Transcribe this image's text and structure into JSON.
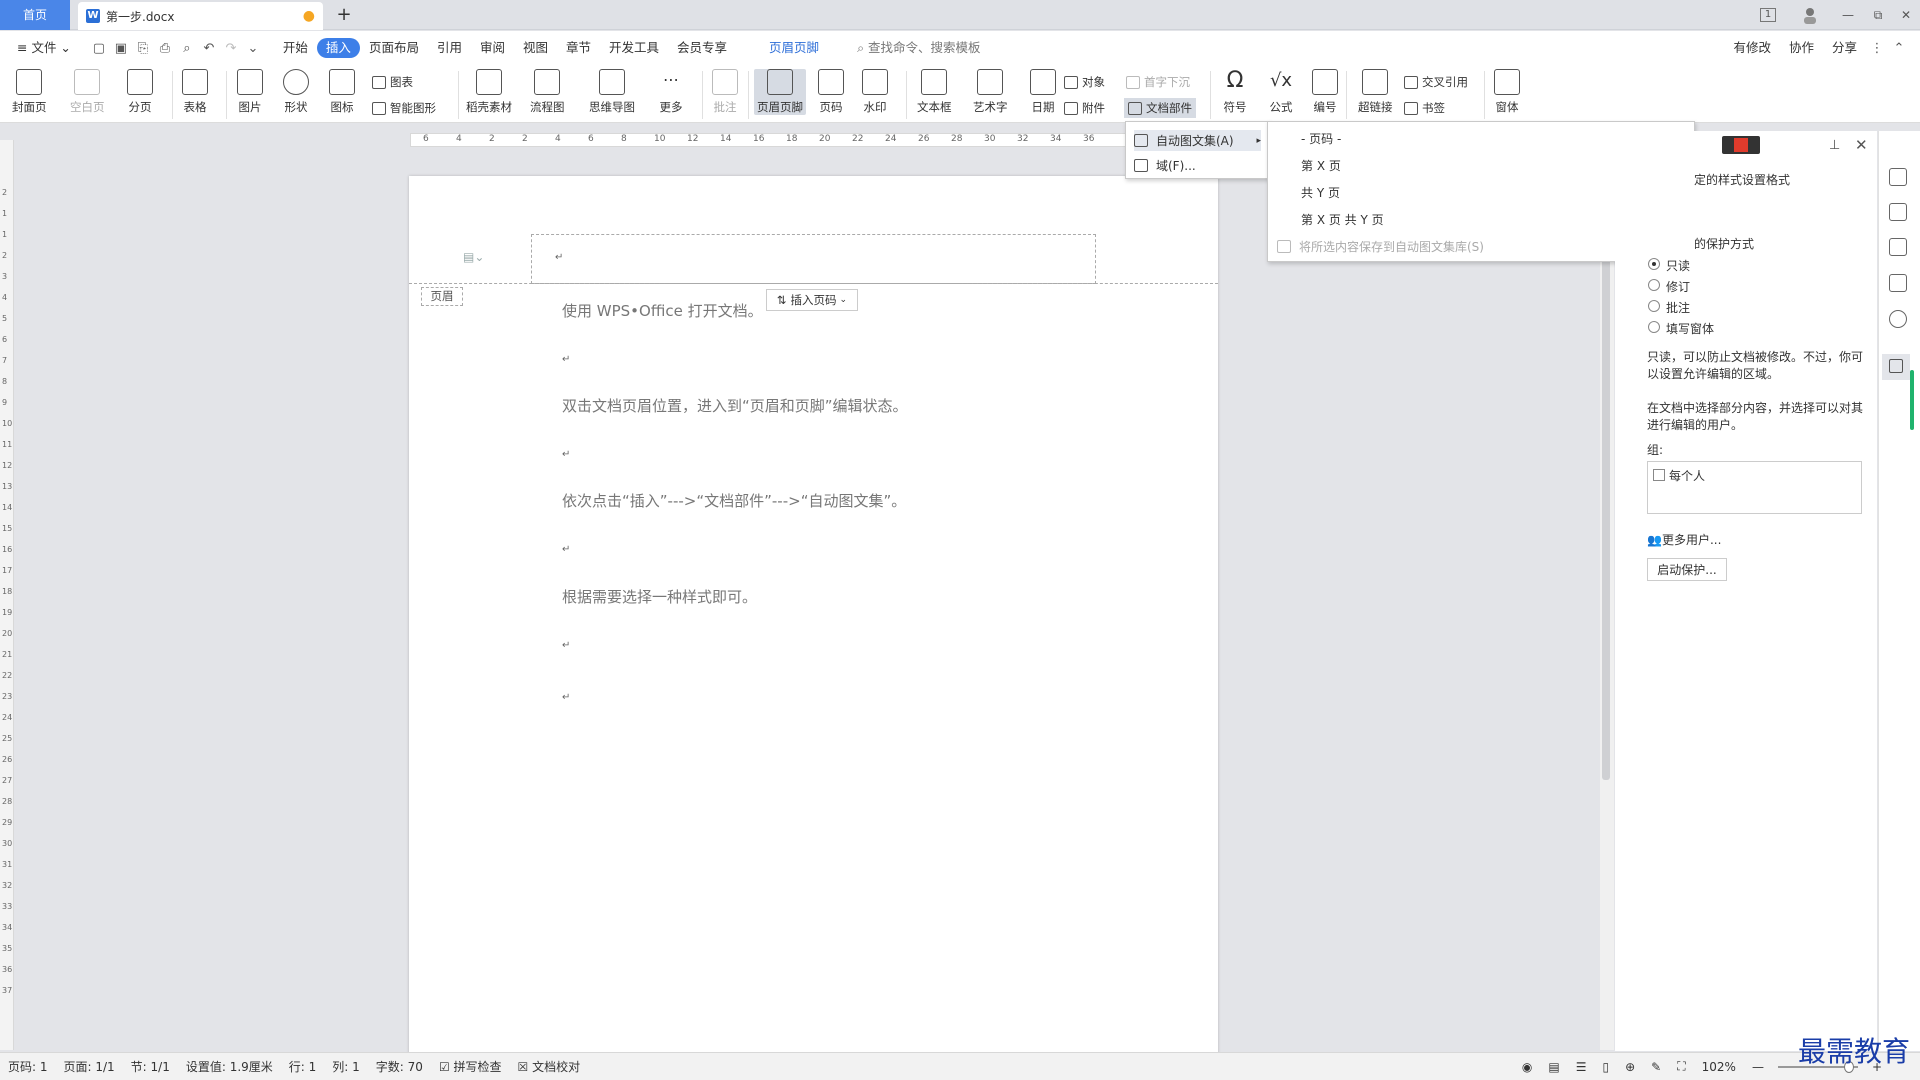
{
  "titlebar": {
    "home_tab": "首页",
    "doc_tab": "第一步.docx",
    "modified_dot": "●",
    "add_tab": "+",
    "ctrl_1": "1",
    "minimize": "—",
    "restore": "⧉",
    "close": "✕"
  },
  "menubar": {
    "file": "≡ 文件 ⌄",
    "tabs": [
      "开始",
      "插入",
      "页面布局",
      "引用",
      "审阅",
      "视图",
      "章节",
      "开发工具",
      "会员专享",
      "页眉页脚"
    ],
    "search": "查找命令、搜索模板",
    "right": [
      "有修改",
      "协作",
      "分享"
    ]
  },
  "ribbon": {
    "buttons": [
      "封面页",
      "空白页",
      "分页",
      "表格",
      "图片",
      "形状",
      "图标",
      "稻壳素材",
      "流程图",
      "思维导图",
      "更多",
      "批注",
      "页眉页脚",
      "页码",
      "水印",
      "文本框",
      "艺术字",
      "日期",
      "编号",
      "超链接",
      "窗体",
      "符号",
      "公式"
    ],
    "small": {
      "chart": "图表",
      "smart": "智能图形",
      "object": "对象",
      "dropcap": "首字下沉",
      "attachment": "附件",
      "docparts": "文档部件",
      "crossref": "交叉引用",
      "bookmark": "书签"
    }
  },
  "ruler_top": [
    "6",
    "4",
    "2",
    "2",
    "4",
    "6",
    "8",
    "10",
    "12",
    "14",
    "16",
    "18",
    "20",
    "22",
    "24",
    "26",
    "28",
    "30",
    "32",
    "34",
    "36"
  ],
  "ruler_left": [
    "2",
    "1",
    "1",
    "2",
    "3",
    "4",
    "5",
    "6",
    "7",
    "8",
    "9",
    "10",
    "11",
    "12",
    "13",
    "14",
    "15",
    "16",
    "17",
    "18",
    "19",
    "20",
    "21",
    "22",
    "23",
    "24",
    "25",
    "26",
    "27",
    "28",
    "29",
    "30",
    "31",
    "32",
    "33",
    "34",
    "35",
    "36",
    "37"
  ],
  "document": {
    "header_tag": "页眉",
    "insert_page_number": "插入页码",
    "return_mark": "↵",
    "paragraphs": [
      "使用 WPS•Office 打开文档。",
      "双击文档页眉位置，进入到“页眉和页脚”编辑状态。",
      "依次点击“插入”--->“文档部件”--->“自动图文集”。",
      "根据需要选择一种样式即可。"
    ]
  },
  "dropdown": {
    "autotext": "自动图文集(A)",
    "field": "域(F)...",
    "submenu": [
      "- 页码 -",
      "第 X 页",
      "共 Y 页",
      "第 X 页 共 Y 页"
    ],
    "save_to_gallery": "将所选内容保存到自动图文集库(S)"
  },
  "panel": {
    "heading_partial": "定的样式设置格式",
    "protect_label": "的保护方式",
    "options": [
      "只读",
      "修订",
      "批注",
      "填写窗体"
    ],
    "readonly_desc_1": "只读，可以防止文档被修改。不过，你可",
    "readonly_desc_2": "以设置允许编辑的区域。",
    "select_desc_1": "在文档中选择部分内容，并选择可以对其",
    "select_desc_2": "进行编辑的用户。",
    "group_label": "组:",
    "everyone": "每个人",
    "more_users": "更多用户...",
    "start_protect": "启动保护..."
  },
  "statusbar": {
    "page_num": "页码: 1",
    "pages": "页面: 1/1",
    "section": "节: 1/1",
    "setting": "设置值: 1.9厘米",
    "row": "行: 1",
    "col": "列: 1",
    "words": "字数: 70",
    "spell": "拼写检查",
    "proof": "文档校对",
    "zoom": "102%"
  },
  "watermark": "最需教育",
  "colors": {
    "accent": "#3d7fe8",
    "brand_tab": "#4a86e8",
    "watermark": "#1a3da8"
  }
}
